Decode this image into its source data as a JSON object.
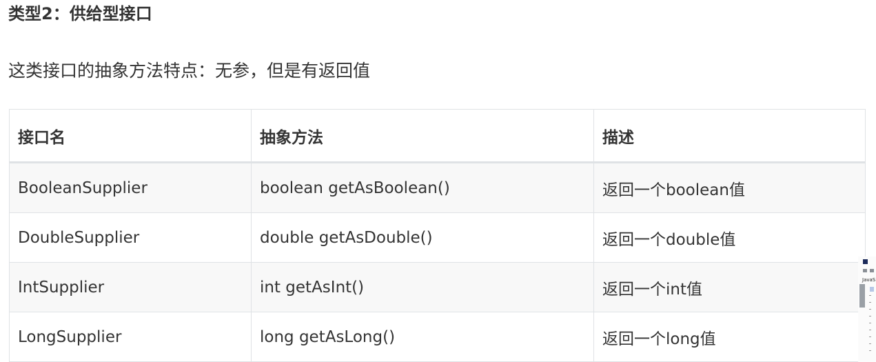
{
  "heading": "类型2：供给型接口",
  "description": "这类接口的抽象方法特点：无参，但是有返回值",
  "table": {
    "headers": [
      "接口名",
      "抽象方法",
      "描述"
    ],
    "rows": [
      [
        "BooleanSupplier",
        "boolean getAsBoolean()",
        "返回一个boolean值"
      ],
      [
        "DoubleSupplier",
        "double getAsDouble()",
        "返回一个double值"
      ],
      [
        "IntSupplier",
        "int getAsInt()",
        "返回一个int值"
      ],
      [
        "LongSupplier",
        "long getAsLong()",
        "返回一个long值"
      ]
    ]
  },
  "edge_window": {
    "text": "JavaS"
  },
  "colors": {
    "text": "#333333",
    "border": "#dfe2e5",
    "stripe": "#f8f8f8"
  }
}
